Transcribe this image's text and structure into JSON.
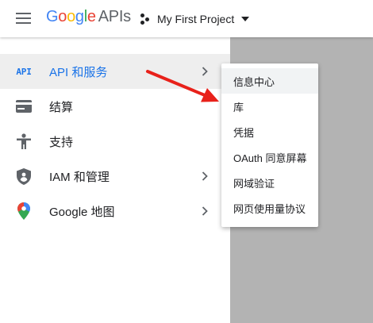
{
  "header": {
    "logo_letters": [
      "G",
      "o",
      "o",
      "g",
      "l",
      "e"
    ],
    "logo_suffix": "APIs",
    "project_name": "My First Project"
  },
  "sidebar": {
    "items": [
      {
        "label": "API 和服务",
        "icon": "api-icon",
        "has_submenu": true,
        "active": true
      },
      {
        "label": "结算",
        "icon": "billing-icon",
        "has_submenu": false
      },
      {
        "label": "支持",
        "icon": "support-icon",
        "has_submenu": false
      },
      {
        "label": "IAM 和管理",
        "icon": "shield-icon",
        "has_submenu": true
      },
      {
        "label": "Google 地图",
        "icon": "maps-pin-icon",
        "has_submenu": true
      }
    ],
    "api_icon_text": "API"
  },
  "submenu": {
    "items": [
      {
        "label": "信息中心",
        "hovered": true
      },
      {
        "label": "库"
      },
      {
        "label": "凭据"
      },
      {
        "label": "OAuth 同意屏幕"
      },
      {
        "label": "网域验证"
      },
      {
        "label": "网页使用量协议"
      }
    ]
  },
  "colors": {
    "google_blue": "#4285F4",
    "google_red": "#EA4335",
    "google_yellow": "#FBBC05",
    "google_green": "#34A853",
    "active_text": "#1a73e8",
    "annotation_arrow": "#e8211a"
  }
}
